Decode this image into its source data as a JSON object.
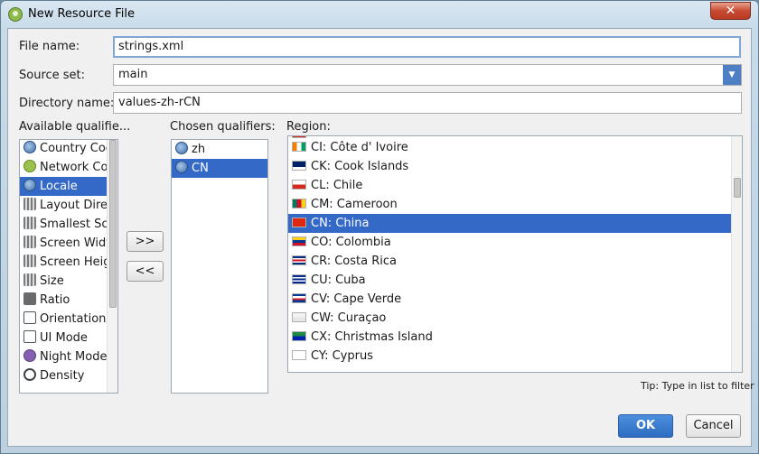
{
  "window": {
    "title": "New Resource File",
    "close_label": "✕"
  },
  "form": {
    "file_name_label": "File name:",
    "file_name_value": "strings.xml",
    "source_set_label": "Source set:",
    "source_set_value": "main",
    "directory_name_label": "Directory name:",
    "directory_name_value": "values-zh-rCN"
  },
  "available": {
    "label": "Available qualifie...",
    "items": [
      {
        "label": "Country Cod",
        "icon": "globe-icon"
      },
      {
        "label": "Network Coc",
        "icon": "android-icon"
      },
      {
        "label": "Locale",
        "icon": "globe-icon",
        "selected": true
      },
      {
        "label": "Layout Direct",
        "icon": "grid-icon"
      },
      {
        "label": "Smallest Scre",
        "icon": "grid-icon"
      },
      {
        "label": "Screen Width",
        "icon": "grid-icon"
      },
      {
        "label": "Screen Heigh",
        "icon": "grid-icon"
      },
      {
        "label": "Size",
        "icon": "grid-icon"
      },
      {
        "label": "Ratio",
        "icon": "ratio-icon"
      },
      {
        "label": "Orientation",
        "icon": "box-icon"
      },
      {
        "label": "UI Mode",
        "icon": "box-icon"
      },
      {
        "label": "Night Mode",
        "icon": "moon-icon"
      },
      {
        "label": "Density",
        "icon": "dot-icon"
      }
    ]
  },
  "buttons": {
    "add_label": ">>",
    "remove_label": "<<",
    "ok_label": "OK",
    "cancel_label": "Cancel"
  },
  "chosen": {
    "label": "Chosen qualifiers:",
    "items": [
      {
        "label": "zh",
        "icon": "globe-icon"
      },
      {
        "label": "CN",
        "icon": "globe-us-icon",
        "selected": true
      }
    ]
  },
  "region": {
    "label": "Region:",
    "items": [
      {
        "label": "CI: Côte d'  Ivoire",
        "flag": [
          "#f77f00",
          "#ffffff",
          "#009e60"
        ],
        "orient": "v"
      },
      {
        "label": "CK: Cook Islands",
        "flag": [
          "#012169",
          "#012169",
          "#ffffff"
        ],
        "orient": "h"
      },
      {
        "label": "CL: Chile",
        "flag": [
          "#ffffff",
          "#d52b1e"
        ],
        "orient": "h"
      },
      {
        "label": "CM: Cameroon",
        "flag": [
          "#007a5e",
          "#ce1126",
          "#fcd116"
        ],
        "orient": "v"
      },
      {
        "label": "CN: China",
        "flag": [
          "#de2910",
          "#de2910"
        ],
        "orient": "h",
        "selected": true
      },
      {
        "label": "CO: Colombia",
        "flag": [
          "#fcd116",
          "#003893",
          "#ce1126"
        ],
        "orient": "h"
      },
      {
        "label": "CR: Costa Rica",
        "flag": [
          "#002b7f",
          "#ffffff",
          "#ce1126",
          "#ffffff",
          "#002b7f"
        ],
        "orient": "h"
      },
      {
        "label": "CU: Cuba",
        "flag": [
          "#002a8f",
          "#ffffff",
          "#002a8f",
          "#ffffff",
          "#002a8f"
        ],
        "orient": "h"
      },
      {
        "label": "CV: Cape Verde",
        "flag": [
          "#003893",
          "#ffffff",
          "#cf2027",
          "#003893"
        ],
        "orient": "h"
      },
      {
        "label": "CW: Curaçao",
        "flag": [
          "#f2f2f2",
          "#e6e6e6"
        ],
        "orient": "h"
      },
      {
        "label": "CX: Christmas Island",
        "flag": [
          "#1c8a42",
          "#0021ad"
        ],
        "orient": "h"
      },
      {
        "label": "CY: Cyprus",
        "flag": [
          "#ffffff",
          "#ffffff"
        ],
        "orient": "h"
      }
    ],
    "tip": "Tip: Type in list to filter"
  },
  "colors": {
    "selection": "#3469c8",
    "ok_button": "#2d6cc0"
  }
}
